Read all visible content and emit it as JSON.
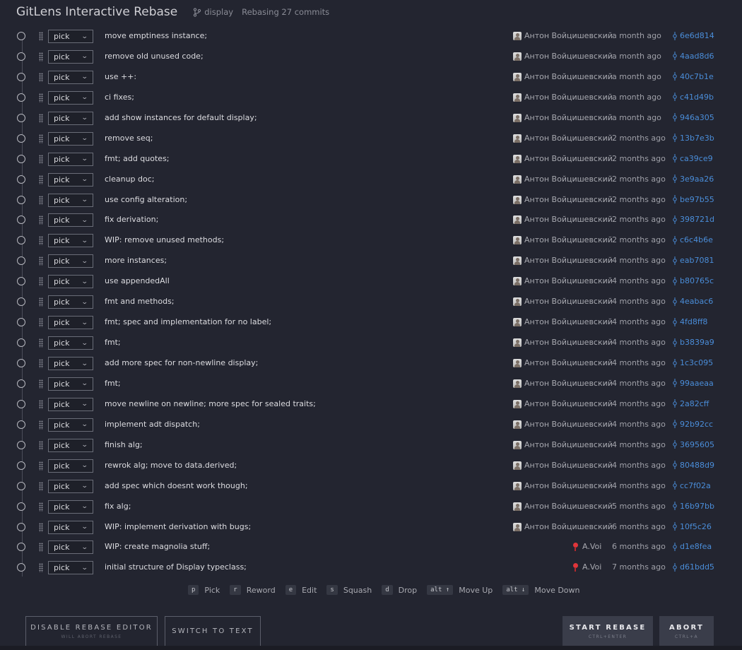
{
  "header": {
    "title": "GitLens Interactive Rebase",
    "branch": "display",
    "status": "Rebasing 27 commits"
  },
  "action_options": [
    "pick",
    "reword",
    "edit",
    "squash",
    "drop"
  ],
  "colors": {
    "background": "#232530",
    "commit_link": "#4a8dd9",
    "primary_button": "#3a3d4a"
  },
  "entries": [
    {
      "action": "pick",
      "message": "move emptiness instance;",
      "author": "Антон Войцишевский",
      "date": "a month ago",
      "sha": "6e6d814",
      "avatar": "default-avatar-icon"
    },
    {
      "action": "pick",
      "message": "remove old unused code;",
      "author": "Антон Войцишевский",
      "date": "a month ago",
      "sha": "4aad8d6",
      "avatar": "default-avatar-icon"
    },
    {
      "action": "pick",
      "message": "use ++:",
      "author": "Антон Войцишевский",
      "date": "a month ago",
      "sha": "40c7b1e",
      "avatar": "default-avatar-icon"
    },
    {
      "action": "pick",
      "message": "ci fixes;",
      "author": "Антон Войцишевский",
      "date": "a month ago",
      "sha": "c41d49b",
      "avatar": "default-avatar-icon"
    },
    {
      "action": "pick",
      "message": "add show instances for default display;",
      "author": "Антон Войцишевский",
      "date": "a month ago",
      "sha": "946a305",
      "avatar": "default-avatar-icon"
    },
    {
      "action": "pick",
      "message": "remove seq;",
      "author": "Антон Войцишевский",
      "date": "2 months ago",
      "sha": "13b7e3b",
      "avatar": "default-avatar-icon"
    },
    {
      "action": "pick",
      "message": "fmt; add quotes;",
      "author": "Антон Войцишевский",
      "date": "2 months ago",
      "sha": "ca39ce9",
      "avatar": "default-avatar-icon"
    },
    {
      "action": "pick",
      "message": "cleanup doc;",
      "author": "Антон Войцишевский",
      "date": "2 months ago",
      "sha": "3e9aa26",
      "avatar": "default-avatar-icon"
    },
    {
      "action": "pick",
      "message": "use config alteration;",
      "author": "Антон Войцишевский",
      "date": "2 months ago",
      "sha": "be97b55",
      "avatar": "default-avatar-icon"
    },
    {
      "action": "pick",
      "message": "fix derivation;",
      "author": "Антон Войцишевский",
      "date": "2 months ago",
      "sha": "398721d",
      "avatar": "default-avatar-icon"
    },
    {
      "action": "pick",
      "message": "WIP: remove unused methods;",
      "author": "Антон Войцишевский",
      "date": "2 months ago",
      "sha": "c6c4b6e",
      "avatar": "default-avatar-icon"
    },
    {
      "action": "pick",
      "message": "more instances;",
      "author": "Антон Войцишевский",
      "date": "4 months ago",
      "sha": "eab7081",
      "avatar": "default-avatar-icon"
    },
    {
      "action": "pick",
      "message": "use appendedAll",
      "author": "Антон Войцишевский",
      "date": "4 months ago",
      "sha": "b80765c",
      "avatar": "default-avatar-icon"
    },
    {
      "action": "pick",
      "message": "fmt and methods;",
      "author": "Антон Войцишевский",
      "date": "4 months ago",
      "sha": "4eabac6",
      "avatar": "default-avatar-icon"
    },
    {
      "action": "pick",
      "message": "fmt; spec and implementation for no label;",
      "author": "Антон Войцишевский",
      "date": "4 months ago",
      "sha": "4fd8ff8",
      "avatar": "default-avatar-icon"
    },
    {
      "action": "pick",
      "message": "fmt;",
      "author": "Антон Войцишевский",
      "date": "4 months ago",
      "sha": "b3839a9",
      "avatar": "default-avatar-icon"
    },
    {
      "action": "pick",
      "message": "add more spec for non-newline display;",
      "author": "Антон Войцишевский",
      "date": "4 months ago",
      "sha": "1c3c095",
      "avatar": "default-avatar-icon"
    },
    {
      "action": "pick",
      "message": "fmt;",
      "author": "Антон Войцишевский",
      "date": "4 months ago",
      "sha": "99aaeaa",
      "avatar": "default-avatar-icon"
    },
    {
      "action": "pick",
      "message": "move newline on newline; more spec for sealed traits;",
      "author": "Антон Войцишевский",
      "date": "4 months ago",
      "sha": "2a82cff",
      "avatar": "default-avatar-icon"
    },
    {
      "action": "pick",
      "message": "implement adt dispatch;",
      "author": "Антон Войцишевский",
      "date": "4 months ago",
      "sha": "92b92cc",
      "avatar": "default-avatar-icon"
    },
    {
      "action": "pick",
      "message": "finish alg;",
      "author": "Антон Войцишевский",
      "date": "4 months ago",
      "sha": "3695605",
      "avatar": "default-avatar-icon"
    },
    {
      "action": "pick",
      "message": "rewrok alg; move to data.derived;",
      "author": "Антон Войцишевский",
      "date": "4 months ago",
      "sha": "80488d9",
      "avatar": "default-avatar-icon"
    },
    {
      "action": "pick",
      "message": "add spec which doesnt work though;",
      "author": "Антон Войцишевский",
      "date": "4 months ago",
      "sha": "cc7f02a",
      "avatar": "default-avatar-icon"
    },
    {
      "action": "pick",
      "message": "fix alg;",
      "author": "Антон Войцишевский",
      "date": "5 months ago",
      "sha": "16b97bb",
      "avatar": "default-avatar-icon"
    },
    {
      "action": "pick",
      "message": "WIP: implement derivation with bugs;",
      "author": "Антон Войцишевский",
      "date": "6 months ago",
      "sha": "10f5c26",
      "avatar": "default-avatar-icon"
    },
    {
      "action": "pick",
      "message": "WIP: create magnolia stuff;",
      "author": "A.Voi",
      "date": "6 months ago",
      "sha": "d1e8fea",
      "avatar": "pin-avatar-icon"
    },
    {
      "action": "pick",
      "message": "initial structure of Display typeclass;",
      "author": "A.Voi",
      "date": "7 months ago",
      "sha": "d61bdd5",
      "avatar": "pin-avatar-icon"
    }
  ],
  "shortcuts": [
    {
      "key": "p",
      "label": "Pick"
    },
    {
      "key": "r",
      "label": "Reword"
    },
    {
      "key": "e",
      "label": "Edit"
    },
    {
      "key": "s",
      "label": "Squash"
    },
    {
      "key": "d",
      "label": "Drop"
    },
    {
      "key": "alt ↑",
      "label": "Move Up"
    },
    {
      "key": "alt ↓",
      "label": "Move Down"
    }
  ],
  "buttons": {
    "disable": {
      "label": "DISABLE REBASE EDITOR",
      "sub": "WILL ABORT REBASE"
    },
    "switch": {
      "label": "SWITCH TO TEXT"
    },
    "start": {
      "label": "START REBASE",
      "sub": "CTRL+ENTER"
    },
    "abort": {
      "label": "ABORT",
      "sub": "CTRL+A"
    }
  }
}
